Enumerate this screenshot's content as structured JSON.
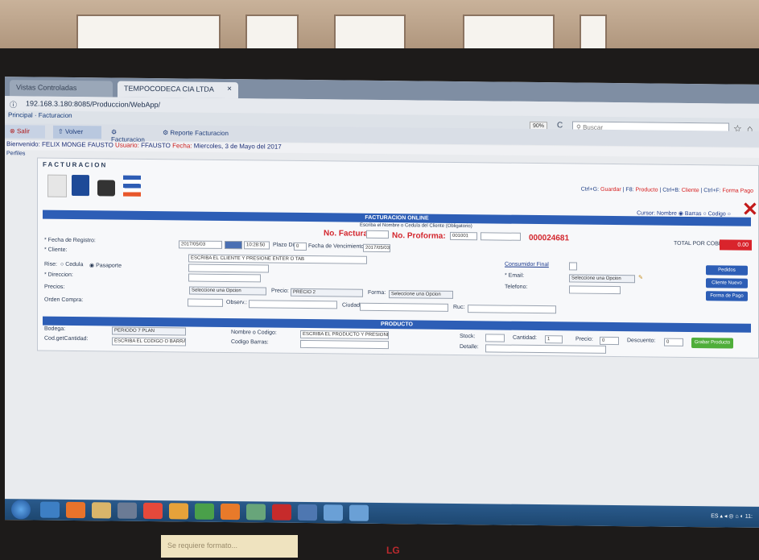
{
  "browser": {
    "tab_inactive": "Vistas Controladas",
    "tab_active": "TEMPOCODECA CIA LTDA",
    "tab_close": "×",
    "address": "192.168.3.180:8085/Produccion/WebApp/",
    "breadcrumb": "Principal · Facturacion",
    "zoom": "90%",
    "reload": "C",
    "search_placeholder": "Buscar",
    "star": "☆",
    "home": "⌂"
  },
  "menubar": {
    "salir": "Salir",
    "volver": "Volver",
    "facturacion": "Facturacion",
    "reporte": "Reporte Facturacion"
  },
  "userline": {
    "prefix": "Bienvenido:",
    "name": "FELIX MONGE FAUSTO",
    "user_label": "Usuario:",
    "user": "FFAUSTO",
    "date_label": "Fecha:",
    "date": "Miercoles, 3 de Mayo del 2017"
  },
  "reset": "Perfiles",
  "app": {
    "title": "FACTURACION",
    "shortcuts": {
      "s1_key": "Ctrl+G:",
      "s1_label": "Guardar",
      "s2_key": "| F8:",
      "s2_label": "Producto",
      "s3_key": "| Ctrl+B:",
      "s3_label": "Cliente",
      "s4_key": "| Ctrl+F:",
      "s4_label": "Forma Pago"
    },
    "close": "✕",
    "radio_row": "Cursor: Nombre ◉ Barras ○ Codigo ○",
    "section_main": "FACTURACION ONLINE",
    "subtitle": "Escriba el Nombre o Cedula del Cliente (Obligatorio)",
    "no_factura_label": "No. Factura:",
    "no_proforma_label": "No. Proforma:",
    "proforma_series": "001001",
    "number": "000024681",
    "total_label": "TOTAL POR COBRAR:",
    "total_value": "0.00",
    "fecha_label": "* Fecha de Registro:",
    "fecha_value": "2017/05/03",
    "hora_value": "10:28:50",
    "plazo_label": "Plazo Dias:",
    "plazo_value": "0",
    "venc_label": "Fecha de Vencimiento:",
    "venc_value": "2017/05/03",
    "cliente_label": "* Cliente:",
    "cliente_value": "ESCRIBA EL CLIENTE Y PRESIONE ENTER O TAB",
    "rise_label": "Rise:",
    "cedula_label": "Cedula",
    "pasaporte_label": "Pasaporte",
    "direccion_label": "* Direccion:",
    "precio_label": "Precios:",
    "precio_select": "Seleccione una Opcion",
    "precio2_label": "Precio:",
    "precio2_value": "PRECIO 2",
    "forma_label": "Forma:",
    "forma_value": "Seleccione una Opcion",
    "orden_label": "Orden Compra:",
    "observ_label": "Observ.:",
    "ciudad_label": "Ciudad:",
    "ruc_label": "Ruc:",
    "consumidor_link": "Consumidor Final",
    "email_label": "* Email:",
    "email_select": "Seleccione una Opcion",
    "telefono_label": "Telefono:",
    "btn_pedidos": "Pedidos",
    "btn_cliente": "Cliente Nuevo",
    "btn_forma": "Forma de Pago",
    "section_producto": "PRODUCTO",
    "bodega_label": "Bodega:",
    "bodega_value": "PERIODO 7 PLAN",
    "nombre_label": "Nombre o Codigo:",
    "nombre_value": "ESCRIBA EL PRODUCTO Y PRESIONE...",
    "barras_label": "Codigo Barras:",
    "cod_cant_label": "Cod.getCantidad:",
    "cod_cant_value": "ESCRIBA EL CODIGO O BARRAS",
    "stock_label": "Stock:",
    "cantidad_label": "Cantidad:",
    "cantidad_value": "1",
    "precio_prod_label": "Precio:",
    "precio_prod_value": "0",
    "desc_label": "Descuento:",
    "desc_value": "0",
    "detalle_label": "Detalle:",
    "btn_grabar": "Grabar Producto"
  },
  "taskbar": {
    "tray": "ES  ▴  ◂  ◎  ⌂  ◐  11:"
  },
  "monitor": {
    "sticky": "Se requiere formato...",
    "brand": "LG"
  },
  "colors": {
    "accent_blue": "#2d5eb6",
    "alert_red": "#d3262d",
    "green": "#4fae3a"
  }
}
